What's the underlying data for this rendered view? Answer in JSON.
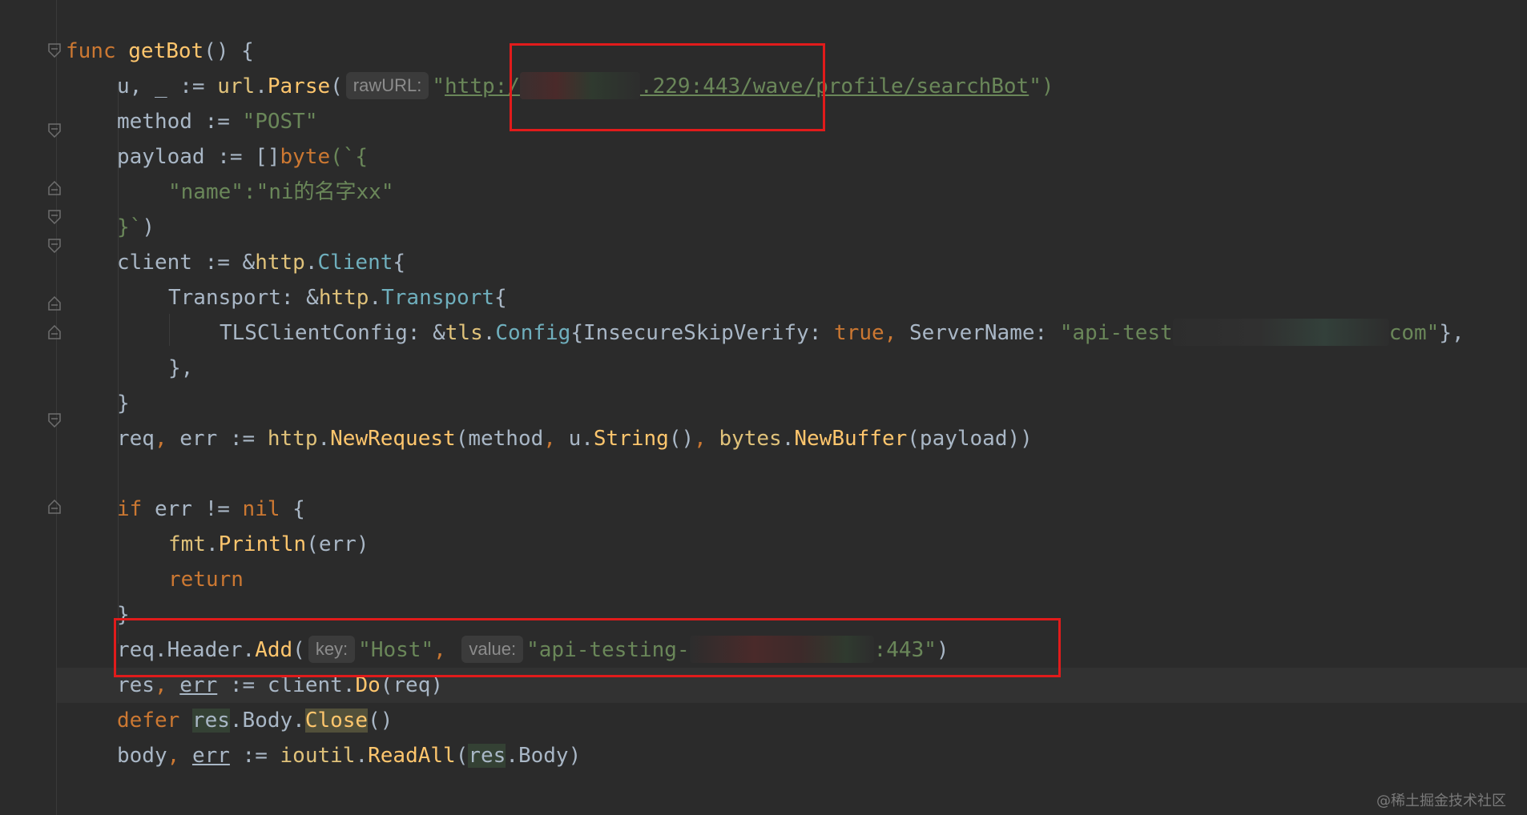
{
  "code": {
    "l1": {
      "func": "func",
      "name": "getBot",
      "rest": "() {"
    },
    "l2": {
      "vars": "u, _ :=",
      "pkg": "url",
      "dot": ".",
      "call": "Parse",
      "open": "(",
      "hint": "rawURL:",
      "q": "\"",
      "url_a": "http:/",
      "url_b": ".229:443/wave/profile/searchBot",
      "close": "\")"
    },
    "l3": {
      "id": "method :=",
      "str": "\"POST\""
    },
    "l4": {
      "id": "payload := []",
      "kw": "byte",
      "rest": "(`{"
    },
    "l5": {
      "str": "\"name\":\"ni的名字xx\""
    },
    "l6": {
      "str": "}`",
      "rest": ")"
    },
    "l7": {
      "id": "client := &",
      "pkg": "http",
      "dot": ".",
      "type": "Client",
      "rest": "{"
    },
    "l8": {
      "id": "Transport: &",
      "pkg": "http",
      "dot": ".",
      "type": "Transport",
      "rest": "{"
    },
    "l9": {
      "id": "TLSClientConfig: &",
      "pkg": "tls",
      "dot": ".",
      "type": "Config",
      "mid": "{InsecureSkipVerify: ",
      "kw": "true",
      "comma": ", ",
      "id2": "ServerName: ",
      "str_a": "\"api-test",
      "str_b": "com\"",
      "rest": "},"
    },
    "l10": {
      "rest": "},"
    },
    "l11": {
      "rest": "}"
    },
    "l12": {
      "id": "req",
      "c1": ", ",
      "id2": "err := ",
      "pkg": "http",
      "dot": ".",
      "call": "NewRequest",
      "a1": "(method",
      "c2": ", ",
      "a2": "u.",
      "call2": "String",
      "a3": "()",
      "c3": ", ",
      "pkg2": "bytes",
      "dot2": ".",
      "call3": "NewBuffer",
      "a4": "(payload))"
    },
    "l13": {
      "kw": "if",
      "id": " err != ",
      "kw2": "nil",
      "rest": " {"
    },
    "l14": {
      "pkg": "fmt",
      "dot": ".",
      "call": "Println",
      "rest": "(err)"
    },
    "l15": {
      "kw": "return"
    },
    "l16": {
      "rest": "}"
    },
    "l17": {
      "id": "req.Header.",
      "call": "Add",
      "open": "(",
      "hint1": "key:",
      "str1": "\"Host\"",
      "comma": ", ",
      "hint2": "value:",
      "str2_a": "\"api-testing-",
      "str2_b": ":443\"",
      "close": ")"
    },
    "l18": {
      "a": "res",
      "c1": ", ",
      "b": "err",
      "c": " := client.",
      "call": "Do",
      "rest": "(req)"
    },
    "l19": {
      "kw": "defer ",
      "a": "res",
      "b": ".Body.",
      "call": "Close",
      "rest": "()"
    },
    "l20": {
      "id": "body",
      "c1": ", ",
      "b": "err",
      "c": " := ",
      "pkg": "ioutil",
      "dot": ".",
      "call": "ReadAll",
      "open": "(",
      "a": "res",
      "rest": ".Body)"
    }
  },
  "watermark": "@稀土掘金技术社区",
  "colors": {
    "background": "#2b2b2b",
    "keyword": "#cc7832",
    "function": "#ffc66d",
    "string": "#6a8759",
    "type": "#6fafbd",
    "identifier": "#a9b7c6",
    "highlight_box": "#e11b1b"
  }
}
